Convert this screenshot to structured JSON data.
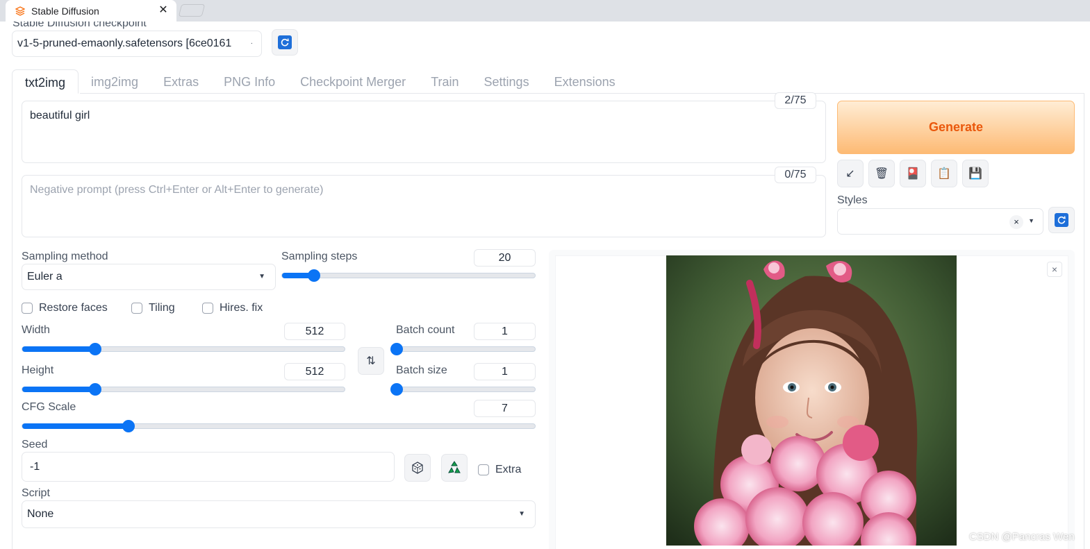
{
  "browser": {
    "tab_title": "Stable Diffusion"
  },
  "checkpoint": {
    "label": "Stable Diffusion checkpoint",
    "value": "v1-5-pruned-emaonly.safetensors [6ce0161"
  },
  "tabs": [
    {
      "label": "txt2img"
    },
    {
      "label": "img2img"
    },
    {
      "label": "Extras"
    },
    {
      "label": "PNG Info"
    },
    {
      "label": "Checkpoint Merger"
    },
    {
      "label": "Train"
    },
    {
      "label": "Settings"
    },
    {
      "label": "Extensions"
    }
  ],
  "prompt": {
    "value": "beautiful girl",
    "counter": "2/75"
  },
  "negative_prompt": {
    "placeholder": "Negative prompt (press Ctrl+Enter or Alt+Enter to generate)",
    "value": "",
    "counter": "0/75"
  },
  "generate": {
    "label": "Generate"
  },
  "tools": {
    "icons": [
      "arrow-down-left-icon",
      "trash-icon",
      "red-card-icon",
      "clipboard-icon",
      "save-icon"
    ],
    "glyphs": [
      "↙",
      "🗑",
      "🎴",
      "📋",
      "💾"
    ]
  },
  "styles": {
    "label": "Styles",
    "clear": "×"
  },
  "sampling": {
    "method_label": "Sampling method",
    "method_value": "Euler a",
    "steps_label": "Sampling steps",
    "steps_value": "20",
    "steps_min": 1,
    "steps_max": 150,
    "steps": 20
  },
  "checks": {
    "restore_faces": "Restore faces",
    "tiling": "Tiling",
    "hires_fix": "Hires. fix"
  },
  "width": {
    "label": "Width",
    "value": "512",
    "min": 64,
    "max": 2048,
    "num": 512
  },
  "height": {
    "label": "Height",
    "value": "512",
    "min": 64,
    "max": 2048,
    "num": 512
  },
  "batch_count": {
    "label": "Batch count",
    "value": "1",
    "min": 1,
    "max": 100,
    "num": 1
  },
  "batch_size": {
    "label": "Batch size",
    "value": "1",
    "min": 1,
    "max": 8,
    "num": 1
  },
  "cfg": {
    "label": "CFG Scale",
    "value": "7",
    "min": 1,
    "max": 30,
    "num": 7
  },
  "swap_glyph": "⇅",
  "seed": {
    "label": "Seed",
    "value": "-1",
    "extra_label": "Extra"
  },
  "script": {
    "label": "Script",
    "value": "None"
  },
  "gallery": {
    "close": "×"
  },
  "watermark": "CSDN @Pancras Wen",
  "colors": {
    "accent": "#0b74f5",
    "generate_text": "#ea580c"
  }
}
